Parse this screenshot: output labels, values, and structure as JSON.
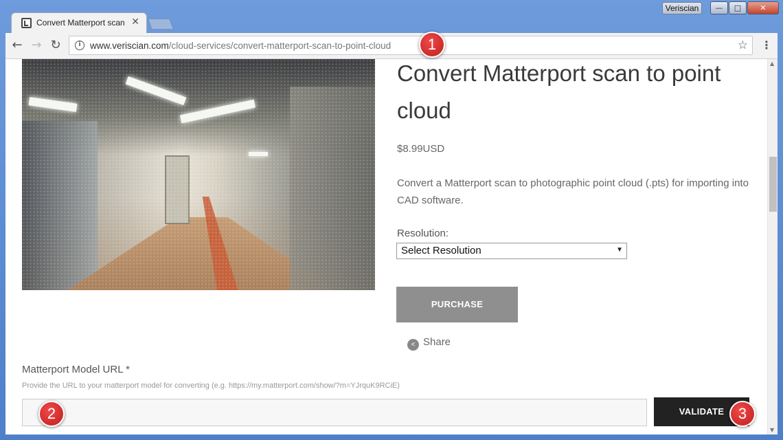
{
  "browser": {
    "tab_title": "Convert Matterport scan",
    "profile_name": "Veriscian",
    "url_domain": "www.veriscian.com",
    "url_path": "/cloud-services/convert-matterport-scan-to-point-cloud",
    "window_buttons": {
      "minimize": "—",
      "maximize": "□",
      "close": "✕"
    }
  },
  "product": {
    "title": "Convert Matterport scan to point cloud",
    "price": "$8.99USD",
    "description": "Convert a Matterport scan to photographic point cloud (.pts) for importing into CAD software.",
    "resolution_label": "Resolution:",
    "resolution_selected": "Select Resolution",
    "purchase_label": "PURCHASE",
    "share_label": "Share"
  },
  "form": {
    "model_url_label": "Matterport Model URL *",
    "model_url_help": "Provide the URL to your matterport model for converting (e.g. https://my.matterport.com/show/?m=YJrquK9RCiE)",
    "model_url_value": "",
    "validate_label": "VALIDATE"
  },
  "annotations": [
    "1",
    "2",
    "3"
  ],
  "colors": {
    "marker": "#d32f2f",
    "purchase_button": "#8f8f8f",
    "validate_button": "#222222",
    "window_frame": "#4f7fc9"
  }
}
